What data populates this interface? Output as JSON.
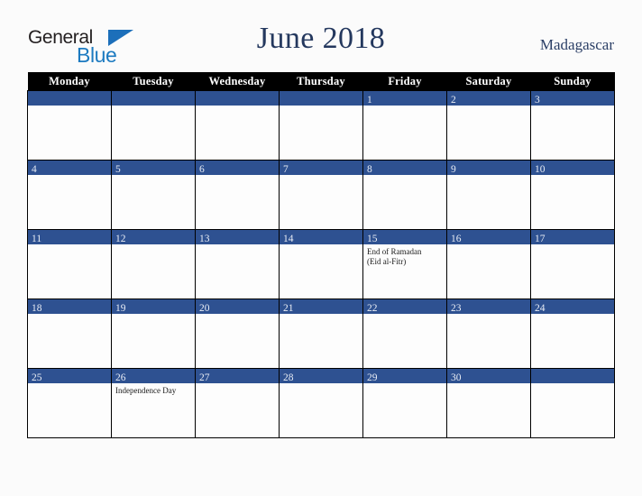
{
  "brand": {
    "name_part1": "General",
    "name_part2": "Blue",
    "triangle_icon": "triangle-icon",
    "accent_dark": "#231f20",
    "accent_blue": "#1c7ac0"
  },
  "header": {
    "title": "June 2018",
    "country": "Madagascar",
    "title_color": "#24385e"
  },
  "calendar": {
    "weekday_headers": [
      "Monday",
      "Tuesday",
      "Wednesday",
      "Thursday",
      "Friday",
      "Saturday",
      "Sunday"
    ],
    "band_color": "#2e5191",
    "header_bg": "#000000",
    "weeks": [
      [
        {
          "day": "",
          "events": []
        },
        {
          "day": "",
          "events": []
        },
        {
          "day": "",
          "events": []
        },
        {
          "day": "",
          "events": []
        },
        {
          "day": "1",
          "events": []
        },
        {
          "day": "2",
          "events": []
        },
        {
          "day": "3",
          "events": []
        }
      ],
      [
        {
          "day": "4",
          "events": []
        },
        {
          "day": "5",
          "events": []
        },
        {
          "day": "6",
          "events": []
        },
        {
          "day": "7",
          "events": []
        },
        {
          "day": "8",
          "events": []
        },
        {
          "day": "9",
          "events": []
        },
        {
          "day": "10",
          "events": []
        }
      ],
      [
        {
          "day": "11",
          "events": []
        },
        {
          "day": "12",
          "events": []
        },
        {
          "day": "13",
          "events": []
        },
        {
          "day": "14",
          "events": []
        },
        {
          "day": "15",
          "events": [
            "End of Ramadan",
            "(Eid al-Fitr)"
          ]
        },
        {
          "day": "16",
          "events": []
        },
        {
          "day": "17",
          "events": []
        }
      ],
      [
        {
          "day": "18",
          "events": []
        },
        {
          "day": "19",
          "events": []
        },
        {
          "day": "20",
          "events": []
        },
        {
          "day": "21",
          "events": []
        },
        {
          "day": "22",
          "events": []
        },
        {
          "day": "23",
          "events": []
        },
        {
          "day": "24",
          "events": []
        }
      ],
      [
        {
          "day": "25",
          "events": []
        },
        {
          "day": "26",
          "events": [
            "Independence Day"
          ]
        },
        {
          "day": "27",
          "events": []
        },
        {
          "day": "28",
          "events": []
        },
        {
          "day": "29",
          "events": []
        },
        {
          "day": "30",
          "events": []
        },
        {
          "day": "",
          "events": []
        }
      ]
    ]
  }
}
